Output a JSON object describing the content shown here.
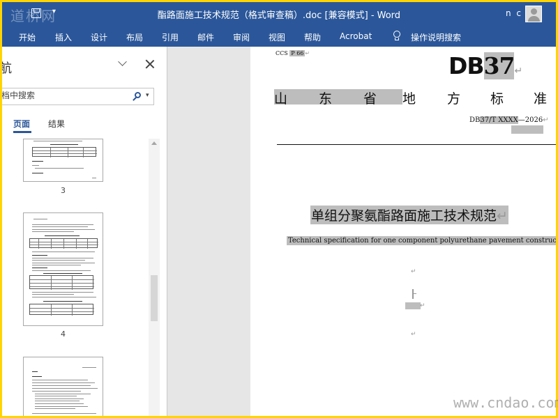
{
  "watermark_top_left": "道桥网",
  "title_bar": {
    "qat_dropdown": "▾",
    "document_title": "酯路面施工技术规范（格式审查稿）.doc [兼容模式]  -  Word",
    "user_name": "n c"
  },
  "ribbon": {
    "tabs": [
      "开始",
      "插入",
      "设计",
      "布局",
      "引用",
      "邮件",
      "审阅",
      "视图",
      "帮助",
      "Acrobat"
    ],
    "tell_me": "操作说明搜索"
  },
  "nav_pane": {
    "title": "航",
    "search_placeholder": "档中搜索",
    "search_dropdown": "▾",
    "tabs": {
      "pages": "页面",
      "results": "结果"
    },
    "thumbnails": [
      {
        "label": "3"
      },
      {
        "label": "4"
      },
      {
        "label": ""
      }
    ]
  },
  "document": {
    "ccs_prefix": "CCS",
    "ccs_code": "P 66",
    "db_letters": "DB",
    "db_number": "37",
    "standard_name_chars": [
      "山",
      "东",
      "省",
      "地",
      "方",
      "标",
      "准"
    ],
    "standard_code_prefix": "DB",
    "standard_code_hl": "37/T  XXXX",
    "standard_code_suffix": "—2026",
    "title_cn": "单组分聚氨酯路面施工技术规范",
    "title_en": "Technical specification for one component polyurethane pavement construction",
    "paragraph_mark": "↵"
  },
  "watermark_bottom_right": "www.cndao.com",
  "colors": {
    "ribbon_blue": "#2b579a",
    "frame_yellow": "#ffd400",
    "highlight_gray": "#bdbdbd"
  }
}
